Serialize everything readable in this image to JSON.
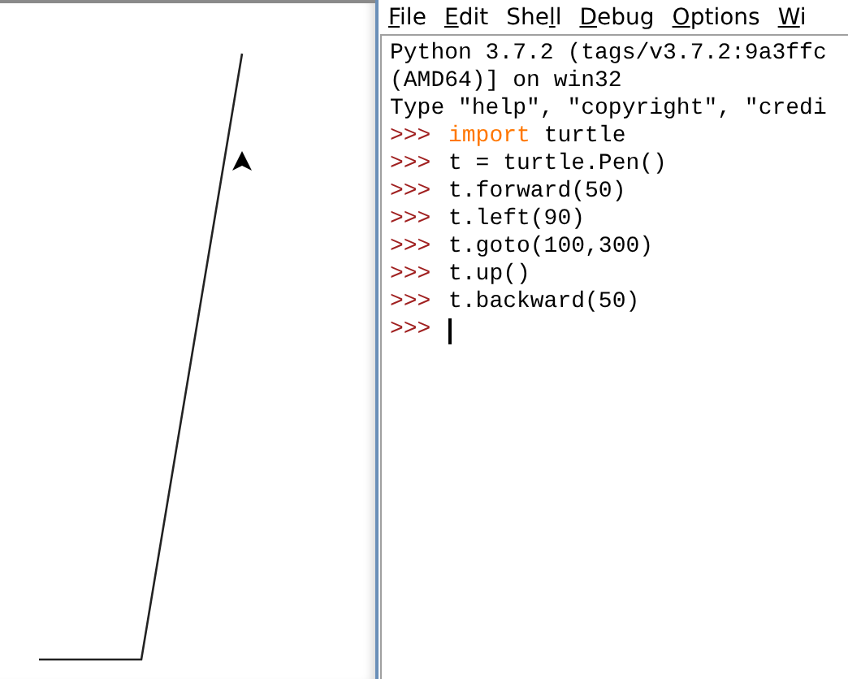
{
  "menu": [
    {
      "key": "F",
      "after": "ile"
    },
    {
      "key": "E",
      "after": "dit"
    },
    {
      "before": "She",
      "key": "l",
      "after": "l"
    },
    {
      "key": "D",
      "after": "ebug"
    },
    {
      "key": "O",
      "after": "ptions"
    },
    {
      "key": "W",
      "after": "i"
    }
  ],
  "shell_lines": [
    {
      "kind": "output",
      "text": "Python 3.7.2 (tags/v3.7.2:9a3ffc"
    },
    {
      "kind": "output",
      "text": "(AMD64)] on win32"
    },
    {
      "kind": "output",
      "text": "Type \"help\", \"copyright\", \"credi"
    },
    {
      "kind": "input",
      "prompt": ">>>",
      "cursor": false,
      "tokens": [
        {
          "kind": "keyword",
          "text": "import"
        },
        {
          "kind": "plain",
          "text": " turtle"
        }
      ]
    },
    {
      "kind": "input",
      "prompt": ">>>",
      "cursor": false,
      "tokens": [
        {
          "kind": "plain",
          "text": "t = turtle.Pen()"
        }
      ]
    },
    {
      "kind": "input",
      "prompt": ">>>",
      "cursor": false,
      "tokens": [
        {
          "kind": "plain",
          "text": "t.forward(50)"
        }
      ]
    },
    {
      "kind": "input",
      "prompt": ">>>",
      "cursor": false,
      "tokens": [
        {
          "kind": "plain",
          "text": "t.left(90)"
        }
      ]
    },
    {
      "kind": "input",
      "prompt": ">>>",
      "cursor": false,
      "tokens": [
        {
          "kind": "plain",
          "text": "t.goto(100,300)"
        }
      ]
    },
    {
      "kind": "input",
      "prompt": ">>>",
      "cursor": false,
      "tokens": [
        {
          "kind": "plain",
          "text": "t.up()"
        }
      ]
    },
    {
      "kind": "input",
      "prompt": ">>>",
      "cursor": false,
      "tokens": [
        {
          "kind": "plain",
          "text": "t.backward(50)"
        }
      ]
    },
    {
      "kind": "input",
      "prompt": ">>>",
      "cursor": true
    }
  ]
}
